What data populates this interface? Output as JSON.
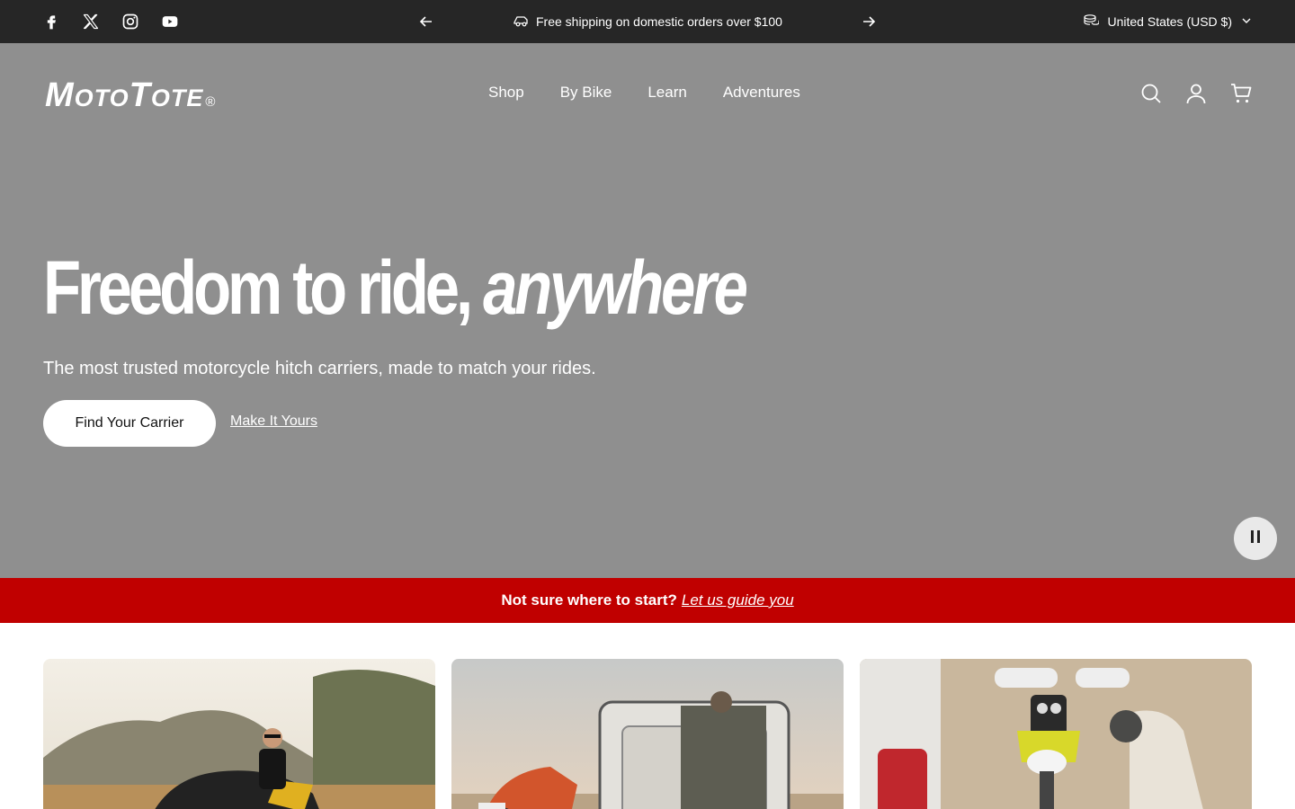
{
  "topbar": {
    "social": [
      "facebook-icon",
      "x-icon",
      "instagram-icon",
      "youtube-icon"
    ],
    "announcement": "Free shipping on domestic orders over $100",
    "currency": "United States (USD $)"
  },
  "header": {
    "logo": "MotoTote",
    "logo_mark": "®",
    "nav": [
      "Shop",
      "By Bike",
      "Learn",
      "Adventures"
    ],
    "icons": [
      "search-icon",
      "account-icon",
      "cart-icon"
    ]
  },
  "hero": {
    "headline_main": "Freedom to ride,",
    "headline_accent": "anywhere",
    "subhead": "The most trusted motorcycle hitch carriers, made to match your rides.",
    "cta_primary": "Find Your Carrier",
    "cta_secondary": "Make It Yours"
  },
  "banner": {
    "text": "Not sure where to start?",
    "link": "Let us guide you"
  },
  "colors": {
    "topbar": "#262626",
    "hero_bg": "#8f8f8f",
    "banner": "#c00000"
  }
}
